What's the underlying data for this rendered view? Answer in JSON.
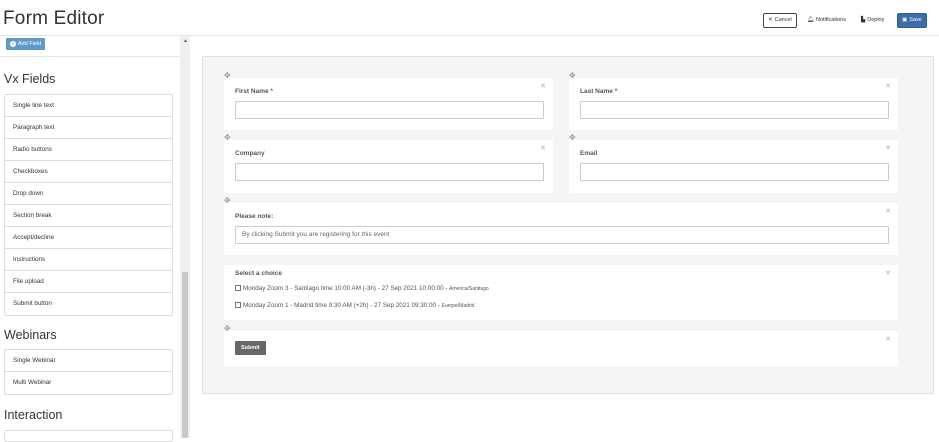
{
  "header": {
    "title": "Form Editor",
    "buttons": {
      "cancel": "Cancel",
      "notifications": "Notifications",
      "deploy": "Deploy",
      "save": "Save"
    }
  },
  "sidebar": {
    "add_field": "Add Field",
    "vx_title": "Vx Fields",
    "vx_items": [
      "Single line text",
      "Paragraph text",
      "Radio buttons",
      "Checkboxes",
      "Drop down",
      "Section break",
      "Accept/decline",
      "Instructions",
      "File upload",
      "Submit button"
    ],
    "webinars_title": "Webinars",
    "webinar_items": [
      "Single Webinar",
      "Multi Webinar"
    ],
    "interaction_title": "Interaction"
  },
  "form": {
    "first_name": "First Name",
    "last_name": "Last Name",
    "required_mark": "*",
    "company": "Company",
    "email": "Email",
    "note_label": "Please note:",
    "note_text": "By clicking Submit you are registering for this event",
    "choice_label": "Select a choice",
    "choices": [
      {
        "text": "Monday Zoom 3 - Santiago time 10:00 AM (-3h) - 27 Sep 2021 10:00:00 - ",
        "tz": "America/Santiago"
      },
      {
        "text": "Monday Zoom 1 - Madrid time 9:30 AM (+2h) - 27 Sep 2021 09:30:00 - ",
        "tz": "Europe/Madrid"
      }
    ],
    "submit": "Submit"
  }
}
